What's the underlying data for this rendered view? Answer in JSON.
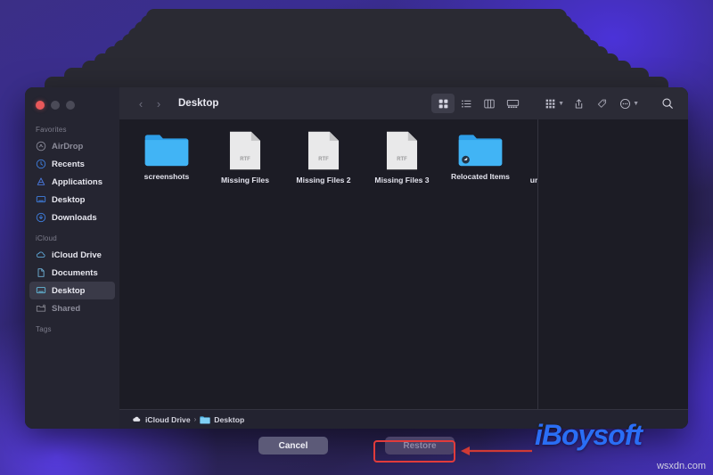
{
  "window": {
    "traffic_lights": [
      "close",
      "minimize",
      "maximize"
    ],
    "toolbar": {
      "back_label": "‹",
      "forward_label": "›",
      "title": "Desktop",
      "icons": [
        "icon-view-icon",
        "list-view-icon",
        "column-view-icon",
        "gallery-view-icon",
        "group-by-icon",
        "chevron-down-icon",
        "share-icon",
        "tag-icon",
        "more-actions-icon",
        "chevron-down-icon",
        "search-icon"
      ]
    }
  },
  "sidebar": {
    "sections": [
      {
        "title": "Favorites",
        "items": [
          {
            "label": "AirDrop",
            "icon": "airdrop-icon",
            "selected": false,
            "dim": true
          },
          {
            "label": "Recents",
            "icon": "clock-icon",
            "selected": false,
            "dim": false
          },
          {
            "label": "Applications",
            "icon": "applications-icon",
            "selected": false,
            "dim": false
          },
          {
            "label": "Desktop",
            "icon": "desktop-icon",
            "selected": false,
            "dim": false
          },
          {
            "label": "Downloads",
            "icon": "downloads-icon",
            "selected": false,
            "dim": false
          }
        ]
      },
      {
        "title": "iCloud",
        "items": [
          {
            "label": "iCloud Drive",
            "icon": "cloud-icon",
            "selected": false,
            "dim": false
          },
          {
            "label": "Documents",
            "icon": "document-icon",
            "selected": false,
            "dim": false
          },
          {
            "label": "Desktop",
            "icon": "desktop-icon",
            "selected": true,
            "dim": false
          },
          {
            "label": "Shared",
            "icon": "shared-folder-icon",
            "selected": false,
            "dim": true
          }
        ]
      },
      {
        "title": "Tags",
        "items": []
      }
    ]
  },
  "files": [
    {
      "name": "screenshots",
      "type": "folder",
      "badge": ""
    },
    {
      "name": "Missing Files",
      "type": "rtf",
      "badge": "RTF"
    },
    {
      "name": "Missing Files 2",
      "type": "rtf",
      "badge": "RTF"
    },
    {
      "name": "Missing Files 3",
      "type": "rtf",
      "badge": "RTF"
    },
    {
      "name": "Relocated Items",
      "type": "folder-alias",
      "badge": ""
    },
    {
      "name": "ur",
      "type": "clipped",
      "badge": ""
    }
  ],
  "pathbar": {
    "crumbs": [
      {
        "label": "iCloud Drive",
        "icon": "cloud-icon"
      },
      {
        "label": "Desktop",
        "icon": "folder-icon"
      }
    ],
    "separator": "›"
  },
  "footer": {
    "cancel_label": "Cancel",
    "restore_label": "Restore",
    "restore_disabled": true,
    "highlight_color": "#e13b3b"
  },
  "watermark": {
    "brand": "iBoysoft",
    "site": "wsxdn.com"
  },
  "colors": {
    "accent_blue": "#2a6ef5",
    "folder_blue": "#3aa9f0",
    "window_bg": "#1c1c25",
    "sidebar_bg": "#252531",
    "toolbar_bg": "#2b2b36",
    "selected_row": "#3a3a48",
    "close_red": "#e8585a"
  }
}
